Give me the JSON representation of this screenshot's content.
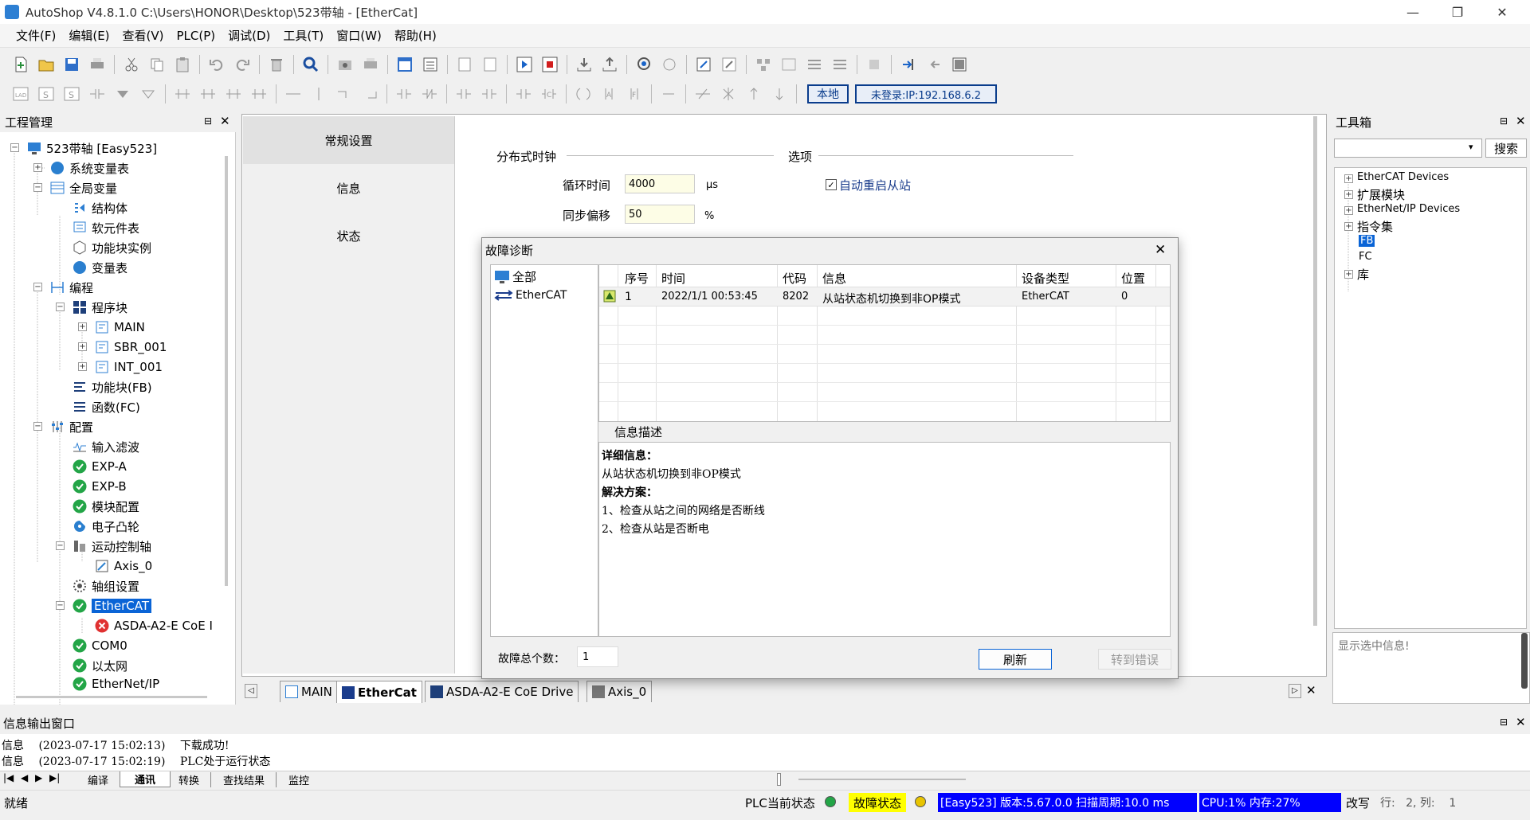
{
  "window": {
    "title": "AutoShop V4.8.1.0  C:\\Users\\HONOR\\Desktop\\523带轴 - [EtherCat]"
  },
  "menu": [
    "文件(F)",
    "编辑(E)",
    "查看(V)",
    "PLC(P)",
    "调试(D)",
    "工具(T)",
    "窗口(W)",
    "帮助(H)"
  ],
  "toolbar2": {
    "local_label": "本地",
    "login_label": "未登录:IP:192.168.6.2"
  },
  "project": {
    "header": "工程管理",
    "items": {
      "root": "523带轴 [Easy523]",
      "sysvars": "系统变量表",
      "globals": "全局变量",
      "struct": "结构体",
      "softcomp": "软元件表",
      "fbinst": "功能块实例",
      "vartable": "变量表",
      "prog": "编程",
      "progblock": "程序块",
      "main": "MAIN",
      "sbr": "SBR_001",
      "int": "INT_001",
      "fb": "功能块(FB)",
      "fc": "函数(FC)",
      "config": "配置",
      "filter": "输入滤波",
      "expa": "EXP-A",
      "expb": "EXP-B",
      "modcfg": "模块配置",
      "ecam": "电子凸轮",
      "motion": "运动控制轴",
      "axis0": "Axis_0",
      "axisgrp": "轴组设置",
      "ethercat": "EtherCAT",
      "asda": "ASDA-A2-E CoE I",
      "com0": "COM0",
      "ethernet": "以太网",
      "ethernetip": "EtherNet/IP"
    }
  },
  "settings_nav": [
    "常规设置",
    "信息",
    "状态"
  ],
  "settings": {
    "dc_label": "分布式时钟",
    "options_label": "选项",
    "cycle_label": "循环时间",
    "cycle_value": "4000",
    "cycle_unit": "μs",
    "sync_label": "同步偏移",
    "sync_value": "50",
    "sync_unit": "%",
    "auto_restart_label": "自动重启从站"
  },
  "dialog": {
    "title": "故障诊断",
    "tree_all": "全部",
    "tree_ethercat": "EtherCAT",
    "columns": [
      "序号",
      "时间",
      "代码",
      "信息",
      "设备类型",
      "位置"
    ],
    "rows": [
      {
        "no": "1",
        "time": "2022/1/1 00:53:45",
        "code": "8202",
        "info": "从站状态机切换到非OP模式",
        "device": "EtherCAT",
        "pos": "0"
      }
    ],
    "desc_label": "信息描述",
    "desc_detail_title": "详细信息：",
    "desc_detail": "从站状态机切换到非OP模式",
    "desc_solution_title": "解决方案：",
    "desc_solution_1": "1、检查从站之间的网络是否断线",
    "desc_solution_2": "2、检查从站是否断电",
    "total_label": "故障总个数：",
    "total_value": "1",
    "refresh_label": "刷新",
    "goto_label": "转到错误"
  },
  "doc_tabs": [
    "MAIN",
    "EtherCat",
    "ASDA-A2-E CoE Drive",
    "Axis_0"
  ],
  "toolbox": {
    "header": "工具箱",
    "search_label": "搜索",
    "items": [
      "EtherCAT Devices",
      "扩展模块",
      "EtherNet/IP Devices",
      "指令集",
      "FB",
      "FC",
      "库"
    ],
    "info_placeholder": "显示选中信息!"
  },
  "output": {
    "header": "信息输出窗口",
    "lines": [
      {
        "type": "信息",
        "time": "(2023-07-17 15:02:13)",
        "msg": "下载成功!"
      },
      {
        "type": "信息",
        "time": "(2023-07-17 15:02:19)",
        "msg": "PLC处于运行状态"
      }
    ],
    "tabs": [
      "编译",
      "通讯",
      "转换",
      "查找结果",
      "监控"
    ]
  },
  "status": {
    "ready": "就绪",
    "plc_state_label": "PLC当前状态",
    "fault_label": "故障状态",
    "version": "[Easy523] 版本:5.67.0.0 扫描周期:10.0 ms",
    "cpu": "CPU:1%  内存:27%",
    "mode": "改写",
    "position": "行:   2, 列:    1"
  },
  "colors": {
    "accent": "#0a64d6",
    "status_blue": "#0000ff",
    "fault_yellow": "#ffff00",
    "ok_green": "#23a547",
    "error_red": "#e03131"
  }
}
